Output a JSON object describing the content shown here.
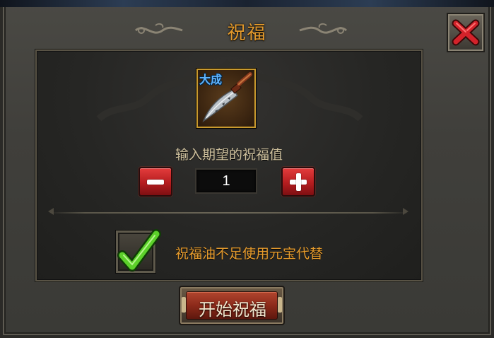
{
  "window": {
    "title": "祝福",
    "close_icon": "close-x-icon"
  },
  "item": {
    "badge": "大成",
    "icon": "dagger-icon",
    "frame_color": "#c99a2e",
    "badge_color": "#5fb4ff"
  },
  "blessing": {
    "prompt": "输入期望的祝福值",
    "value": "1",
    "minus_icon": "minus-icon",
    "plus_icon": "plus-icon"
  },
  "option": {
    "label": "祝福油不足使用元宝代替",
    "checked": true,
    "check_icon": "checkmark-icon"
  },
  "actions": {
    "start_label": "开始祝福"
  },
  "colors": {
    "title": "#e49a2c",
    "accent_red": "#b51d1f",
    "check_green": "#5cd12a"
  }
}
